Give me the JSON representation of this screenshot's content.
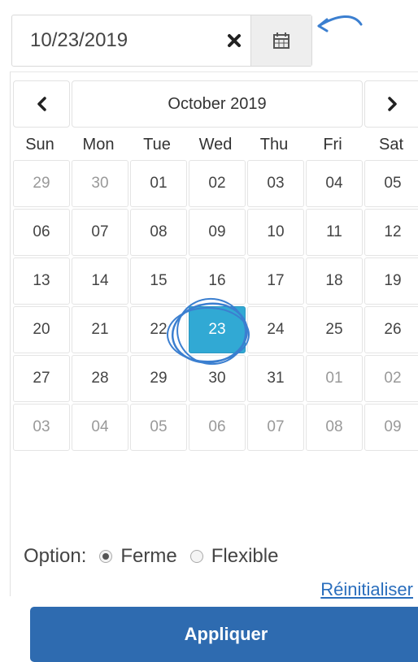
{
  "date_input": {
    "value": "10/23/2019"
  },
  "icons": {
    "clear": "close-icon",
    "calendar": "calendar-icon",
    "prev": "chevron-left-icon",
    "next": "chevron-right-icon"
  },
  "calendar": {
    "month_label": "October 2019",
    "weekdays": [
      "Sun",
      "Mon",
      "Tue",
      "Wed",
      "Thu",
      "Fri",
      "Sat"
    ],
    "days": [
      {
        "label": "29",
        "other": true
      },
      {
        "label": "30",
        "other": true
      },
      {
        "label": "01"
      },
      {
        "label": "02"
      },
      {
        "label": "03"
      },
      {
        "label": "04"
      },
      {
        "label": "05"
      },
      {
        "label": "06"
      },
      {
        "label": "07"
      },
      {
        "label": "08"
      },
      {
        "label": "09"
      },
      {
        "label": "10"
      },
      {
        "label": "11"
      },
      {
        "label": "12"
      },
      {
        "label": "13"
      },
      {
        "label": "14"
      },
      {
        "label": "15"
      },
      {
        "label": "16"
      },
      {
        "label": "17"
      },
      {
        "label": "18"
      },
      {
        "label": "19"
      },
      {
        "label": "20"
      },
      {
        "label": "21"
      },
      {
        "label": "22"
      },
      {
        "label": "23",
        "selected": true
      },
      {
        "label": "24"
      },
      {
        "label": "25"
      },
      {
        "label": "26"
      },
      {
        "label": "27"
      },
      {
        "label": "28"
      },
      {
        "label": "29"
      },
      {
        "label": "30"
      },
      {
        "label": "31"
      },
      {
        "label": "01",
        "other": true
      },
      {
        "label": "02",
        "other": true
      },
      {
        "label": "03",
        "other": true
      },
      {
        "label": "04",
        "other": true
      },
      {
        "label": "05",
        "other": true
      },
      {
        "label": "06",
        "other": true
      },
      {
        "label": "07",
        "other": true
      },
      {
        "label": "08",
        "other": true
      },
      {
        "label": "09",
        "other": true
      }
    ],
    "selected_color": "#31a9d4"
  },
  "options": {
    "label": "Option:",
    "choices": [
      {
        "label": "Ferme",
        "checked": true
      },
      {
        "label": "Flexible",
        "checked": false
      }
    ]
  },
  "reset_label": "Réinitialiser",
  "apply_label": "Appliquer",
  "colors": {
    "apply": "#2e6bb0",
    "annotation": "#3b7fd0"
  }
}
